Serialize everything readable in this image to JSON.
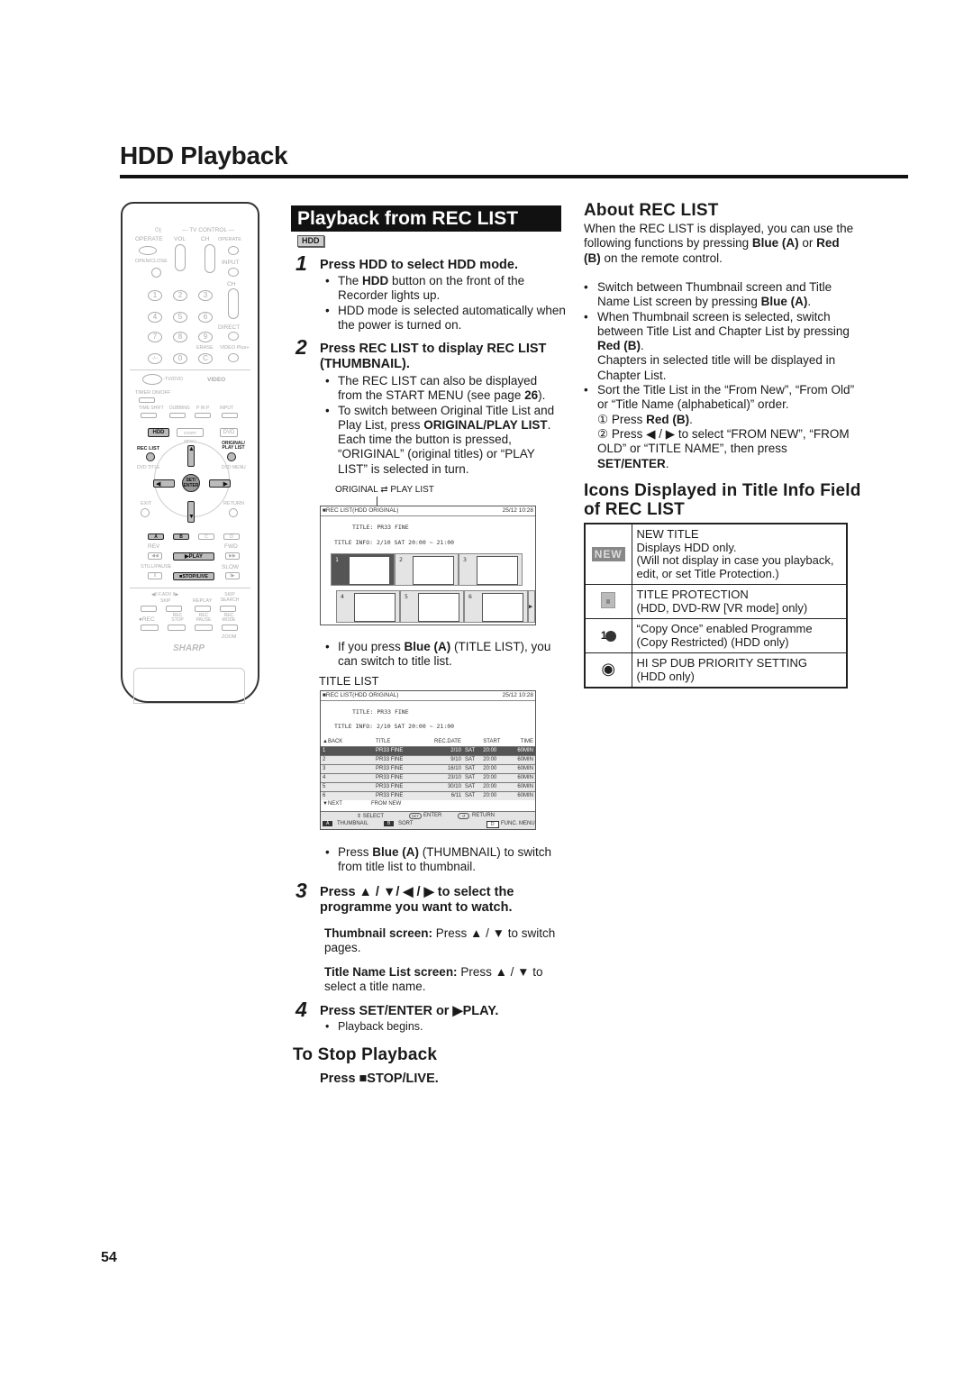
{
  "page": {
    "title": "HDD Playback",
    "page_number": "54"
  },
  "remote": {
    "brand": "SHARP",
    "labels": {
      "tv_control": "— TV CONTROL —",
      "operate": "OPERATE",
      "vol": "VOL",
      "ch": "CH",
      "operate_tv": "OPERATE",
      "open_close": "OPEN/CLOSE",
      "input": "INPUT",
      "ch2": "CH",
      "direct": "DIRECT",
      "erase": "ERASE",
      "video_plus": "VIDEO Plus+",
      "tv_dvd": "-TV/DVD",
      "videoplus_logo": "VIDEO",
      "timer_onoff": "TIMER ON/OFF",
      "time_shift": "TIME SHIFT",
      "dubbing": "DUBBING",
      "pinp": "P IN P",
      "input2": "INPUT",
      "hdd": "HDD",
      "start_menu": "START MENU",
      "dvd": "DVD",
      "rec_list": "REC LIST",
      "original_play_list": "ORIGINAL/ PLAY LIST",
      "dvd_title": "DVD TITLE",
      "dvd_menu": "DVD MENU",
      "set_enter": "SET/ ENTER",
      "exit": "EXIT",
      "return": "RETURN",
      "a": "A",
      "b": "B",
      "c": "C",
      "d": "D",
      "rev": "REV",
      "fwd": "FWD",
      "play": "▶PLAY",
      "still_pause": "STILL/PAUSE",
      "slow": "SLOW",
      "stop_live": "■STOP/LIVE",
      "fadv": "◀II F.ADV II▶",
      "skip": "SKIP",
      "replay": "REPLAY",
      "skip_search": "SKIP SEARCH",
      "rec": "●REC",
      "rec_stop": "REC STOP",
      "rec_pause": "REC PAUSE",
      "rec_mode": "REC MODE",
      "zoom": "ZOOM"
    },
    "numbers": [
      "1",
      "2",
      "3",
      "4",
      "5",
      "6",
      "7",
      "8",
      "9",
      "-/--",
      "0",
      "C"
    ]
  },
  "middle": {
    "section_title": "Playback from REC LIST",
    "badge": "HDD",
    "step1": {
      "num": "1",
      "head_pre": "Press ",
      "head_bold": "HDD",
      "head_post": " to select HDD mode.",
      "bullet1_pre": "The ",
      "bullet1_bold": "HDD",
      "bullet1_post": " button on the front of the Recorder lights up.",
      "bullet2": "HDD mode is selected automatically when the power is turned on."
    },
    "step2": {
      "num": "2",
      "head_pre": "Press ",
      "head_bold": "REC LIST",
      "head_post": " to display REC LIST (THUMBNAIL).",
      "bullet1_pre": "The REC LIST can also be displayed from the START MENU (see page ",
      "bullet1_bold": "26",
      "bullet1_post": ").",
      "bullet2_pre": "To switch between Original Title List and Play List, press ",
      "bullet2_bold": "ORIGINAL/PLAY LIST",
      "bullet2_post": ". Each time the button is pressed, “ORIGINAL” (original titles) or “PLAY LIST” is selected in turn.",
      "toggle_caption": "ORIGINAL ⇄ PLAY LIST"
    },
    "thumb_screen": {
      "bar_left": "■REC LIST(HDD ORIGINAL)",
      "bar_right": "25/12 10:28",
      "title_line": "TITLE: PR33 FINE",
      "info_line": "TITLE INFO: 2/10 SAT 20:00  ~  21:00",
      "cells": [
        "1",
        "2",
        "3",
        "4",
        "5",
        "6"
      ],
      "next_arrow": "▶"
    },
    "after_thumb": {
      "bullet_pre": "If you press ",
      "bullet_bold": "Blue (A)",
      "bullet_post": " (TITLE LIST), you can switch to title list.",
      "caption": "TITLE LIST"
    },
    "title_list_screen": {
      "bar_left": "■REC LIST(HDD ORIGINAL)",
      "bar_right": "25/12 10:28",
      "title_line": "TITLE: PR33 FINE",
      "info_line": "TITLE INFO: 2/10 SAT 20:00  ~  21:00",
      "columns": [
        "▲BACK",
        "TITLE",
        "REC.DATE",
        "",
        "START",
        "TIME"
      ],
      "rows": [
        {
          "no": "1",
          "title": "PR33 FINE",
          "date": "2/10",
          "day": "SAT",
          "start": "20:00",
          "time": "60MIN"
        },
        {
          "no": "2",
          "title": "PR33 FINE",
          "date": "9/10",
          "day": "SAT",
          "start": "20:00",
          "time": "60MIN"
        },
        {
          "no": "3",
          "title": "PR33 FINE",
          "date": "16/10",
          "day": "SAT",
          "start": "20:00",
          "time": "60MIN"
        },
        {
          "no": "4",
          "title": "PR33 FINE",
          "date": "23/10",
          "day": "SAT",
          "start": "20:00",
          "time": "60MIN"
        },
        {
          "no": "5",
          "title": "PR33 FINE",
          "date": "30/10",
          "day": "SAT",
          "start": "20:00",
          "time": "60MIN"
        },
        {
          "no": "6",
          "title": "PR33 FINE",
          "date": "6/11",
          "day": "SAT",
          "start": "20:00",
          "time": "60MIN"
        }
      ],
      "next": "▼NEXT",
      "sort_mode": "FROM NEW",
      "select": "⇕ SELECT",
      "enter": "ENTER",
      "return": "RETURN",
      "a_label": "A",
      "thumbnail": "THUMBNAIL",
      "b_label": "B",
      "sort": "SORT",
      "d_label": "D",
      "func_menu": "FUNC. MENU"
    },
    "after_list": {
      "bullet_pre": "Press ",
      "bullet_bold": "Blue (A)",
      "bullet_post": " (THUMBNAIL) to switch from title list to thumbnail."
    },
    "step3": {
      "num": "3",
      "head": "Press ▲ / ▼/ ◀ / ▶ to select the programme you want to watch.",
      "thumb_bold": "Thumbnail screen:",
      "thumb_text": " Press ▲ / ▼ to switch pages.",
      "list_bold": "Title Name List screen:",
      "list_text": " Press ▲ / ▼ to select a title name."
    },
    "step4": {
      "num": "4",
      "head_pre": "Press ",
      "head_bold1": "SET/ENTER",
      "head_mid": " or ",
      "head_bold2": "▶PLAY",
      "head_post": ".",
      "bullet": "Playback begins."
    },
    "stop": {
      "heading": "To Stop Playback",
      "text_pre": "Press ",
      "text_bold": "■STOP/LIVE",
      "text_post": "."
    }
  },
  "right": {
    "about": {
      "heading": "About REC LIST",
      "intro_1": "When the REC LIST is displayed, you can use the following functions by pressing ",
      "intro_b1": "Blue (A)",
      "intro_2": " or ",
      "intro_b2": "Red (B)",
      "intro_3": " on the remote control.",
      "b1_pre": "Switch between Thumbnail screen and Title Name List screen by pressing ",
      "b1_bold": "Blue (A)",
      "b1_post": ".",
      "b2_pre": "When Thumbnail screen is selected, switch between Title List and Chapter List by pressing ",
      "b2_bold": "Red (B)",
      "b2_post": ".",
      "b2_extra": "Chapters in selected title will be displayed in Chapter List.",
      "b3": "Sort the Title List in the “From New”, “From Old” or “Title Name (alphabetical)” order.",
      "sub1_num": "①",
      "sub1_pre": " Press ",
      "sub1_bold": "Red (B)",
      "sub1_post": ".",
      "sub2_num": "②",
      "sub2_pre": " Press ◀ / ▶ to select “FROM NEW”, “FROM OLD” or “TITLE NAME”, then press ",
      "sub2_bold": "SET/ENTER",
      "sub2_post": "."
    },
    "icons": {
      "heading": "Icons Displayed in Title Info Field of REC LIST",
      "rows": [
        {
          "icon": "new-title-icon",
          "glyph": "NEW",
          "lines": [
            "NEW TITLE",
            "Displays HDD only.",
            "(Will not display in case you playback, edit, or set Title Protection.)"
          ]
        },
        {
          "icon": "title-protection-icon",
          "glyph": "🔒",
          "lines": [
            "TITLE PROTECTION",
            "(HDD, DVD-RW [VR mode] only)"
          ]
        },
        {
          "icon": "copy-once-icon",
          "glyph": "1",
          "lines": [
            "“Copy Once” enabled Programme",
            "(Copy Restricted)  (HDD only)"
          ]
        },
        {
          "icon": "hi-sp-dub-icon",
          "glyph": "◉",
          "lines": [
            "HI SP DUB PRIORITY SETTING",
            "(HDD only)"
          ]
        }
      ]
    }
  }
}
